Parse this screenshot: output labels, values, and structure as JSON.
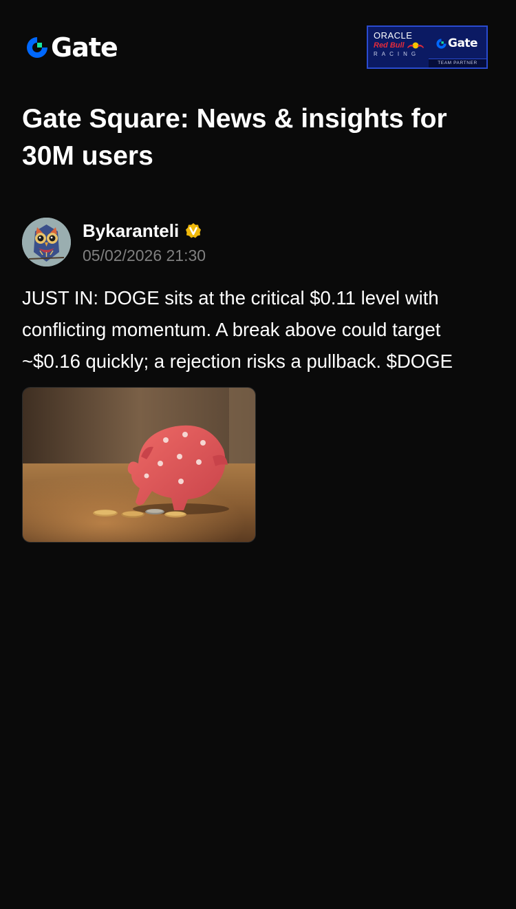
{
  "header": {
    "logo_text": "Gate",
    "logo_icon": "gate-logo-icon",
    "partner": {
      "oracle": "ORACLE",
      "redbull": "Red Bull",
      "racing": "RACING",
      "gate": "Gate",
      "team_partner": "TEAM PARTNER"
    }
  },
  "page": {
    "title": "Gate Square: News & insights for 30M users"
  },
  "post": {
    "author": {
      "name": "Bykaranteli",
      "verified_icon": "verified-badge-icon",
      "avatar_icon": "owl-avatar"
    },
    "timestamp": "05/02/2026 21:30",
    "body": "JUST IN: DOGE sits at the critical $0.11 level with conflicting momentum. A break above could target ~$0.16 quickly; a rejection risks a pullback. $DOGE",
    "image_icon": "piggy-bank-photo"
  },
  "colors": {
    "background": "#0a0a0a",
    "text_primary": "#ffffff",
    "text_secondary": "#808080",
    "gate_blue": "#0068ff",
    "gate_green": "#17e6a1",
    "verified_gold": "#f0b90b",
    "partner_navy": "#0b1a63"
  }
}
